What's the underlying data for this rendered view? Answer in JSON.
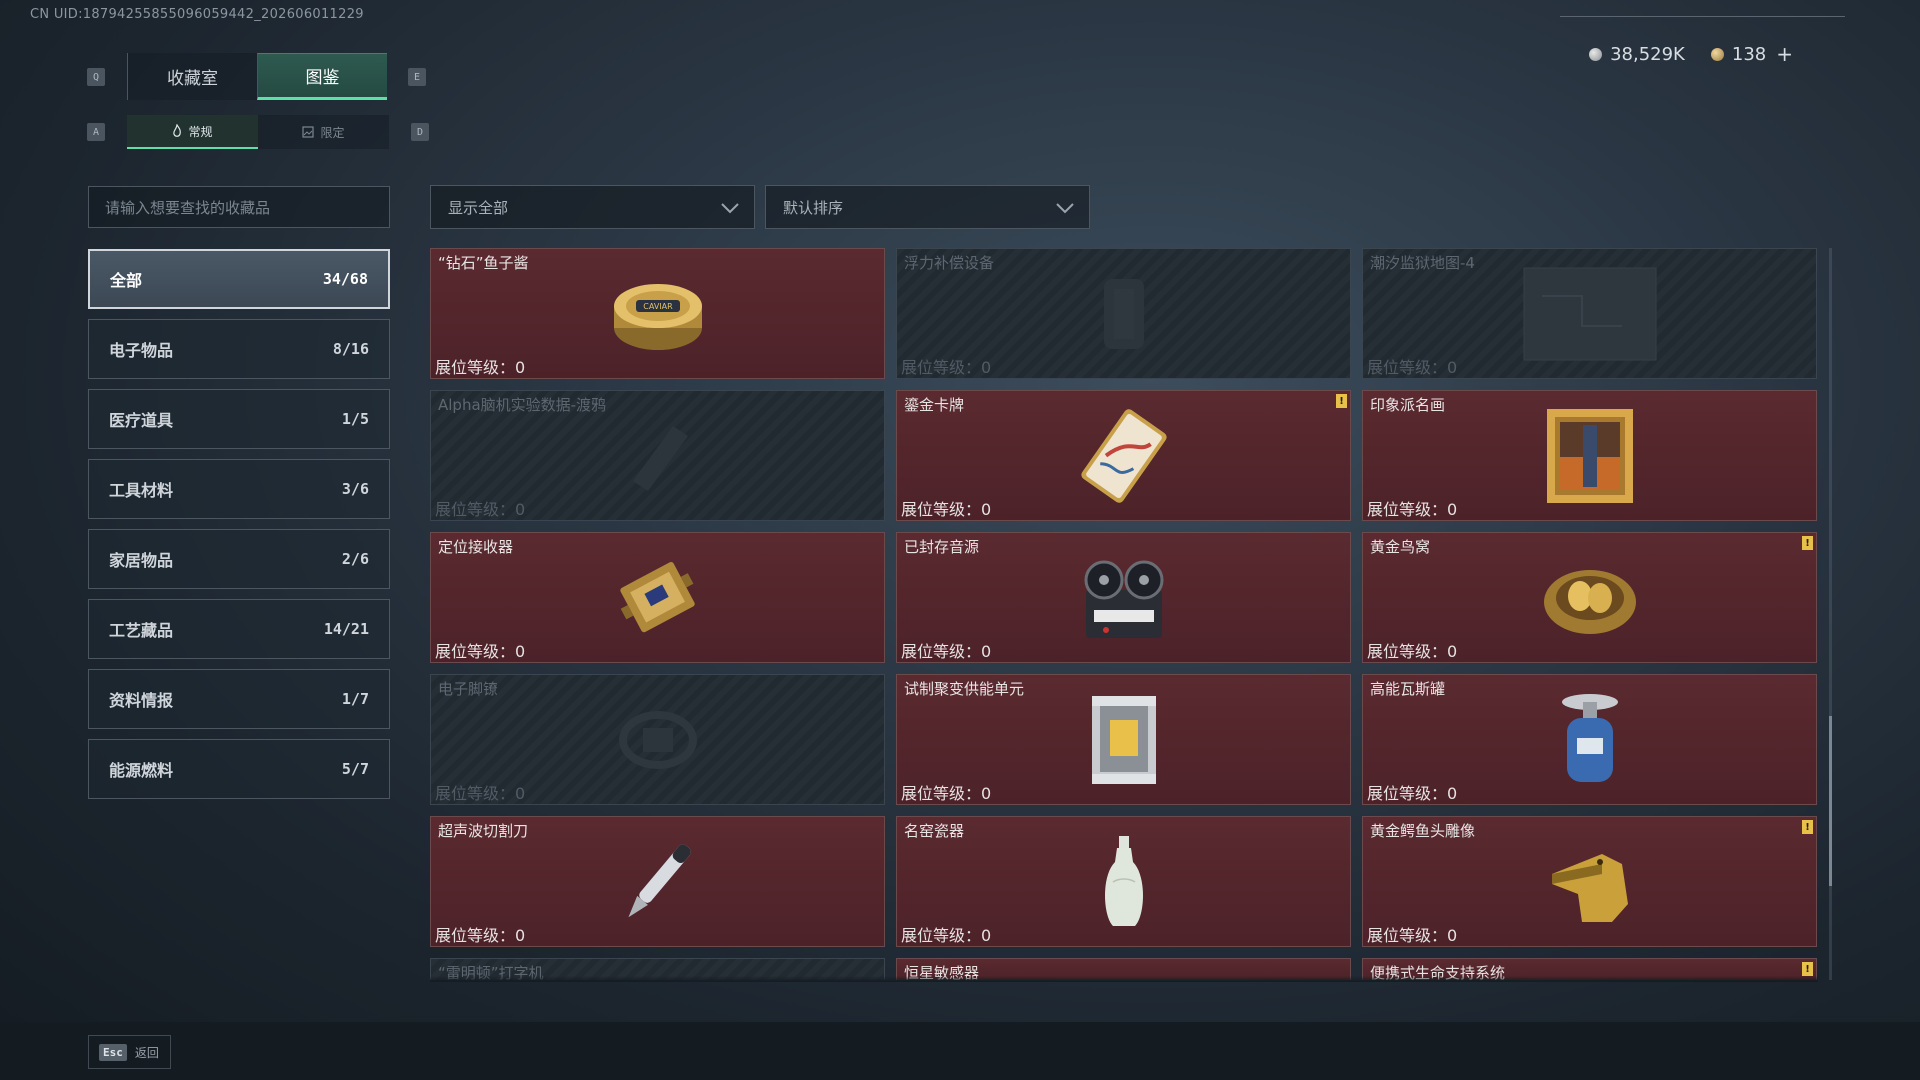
{
  "uid": "CN UID:18794255855096059442_202606011229",
  "currency": {
    "silver": "38,529K",
    "gold": "138",
    "add": "+"
  },
  "keys": {
    "q": "Q",
    "e": "E",
    "a": "A",
    "d": "D"
  },
  "tabs": [
    {
      "label": "收藏室"
    },
    {
      "label": "图鉴"
    }
  ],
  "subtabs": [
    {
      "label": "常规"
    },
    {
      "label": "限定"
    }
  ],
  "search": {
    "placeholder": "请输入想要查找的收藏品"
  },
  "filter": {
    "selected": "显示全部"
  },
  "sort": {
    "selected": "默认排序"
  },
  "categories": [
    {
      "name": "全部",
      "count": "34/68"
    },
    {
      "name": "电子物品",
      "count": "8/16"
    },
    {
      "name": "医疗道具",
      "count": "1/5"
    },
    {
      "name": "工具材料",
      "count": "3/6"
    },
    {
      "name": "家居物品",
      "count": "2/6"
    },
    {
      "name": "工艺藏品",
      "count": "14/21"
    },
    {
      "name": "资料情报",
      "count": "1/7"
    },
    {
      "name": "能源燃料",
      "count": "5/7"
    }
  ],
  "level_label": "展位等级：",
  "items": [
    {
      "name": "“钻石”鱼子酱",
      "level": "0",
      "locked": false,
      "badge": false,
      "icon": "caviar-tin-icon"
    },
    {
      "name": "浮力补偿设备",
      "level": "0",
      "locked": true,
      "badge": false,
      "icon": "buoyancy-device-icon"
    },
    {
      "name": "潮汐监狱地图-4",
      "level": "0",
      "locked": true,
      "badge": false,
      "icon": "map-icon"
    },
    {
      "name": "Alpha脑机实验数据-渡鸦",
      "level": "0",
      "locked": true,
      "badge": false,
      "icon": "data-drive-icon"
    },
    {
      "name": "鎏金卡牌",
      "level": "0",
      "locked": false,
      "badge": true,
      "icon": "gilded-card-icon"
    },
    {
      "name": "印象派名画",
      "level": "0",
      "locked": false,
      "badge": false,
      "icon": "painting-icon"
    },
    {
      "name": "定位接收器",
      "level": "0",
      "locked": false,
      "badge": false,
      "icon": "receiver-icon"
    },
    {
      "name": "已封存音源",
      "level": "0",
      "locked": false,
      "badge": false,
      "icon": "tape-recorder-icon"
    },
    {
      "name": "黄金鸟窝",
      "level": "0",
      "locked": false,
      "badge": true,
      "icon": "golden-nest-icon"
    },
    {
      "name": "电子脚镣",
      "level": "0",
      "locked": true,
      "badge": false,
      "icon": "ankle-monitor-icon"
    },
    {
      "name": "试制聚变供能单元",
      "level": "0",
      "locked": false,
      "badge": false,
      "icon": "fusion-unit-icon"
    },
    {
      "name": "高能瓦斯罐",
      "level": "0",
      "locked": false,
      "badge": false,
      "icon": "gas-canister-icon"
    },
    {
      "name": "超声波切割刀",
      "level": "0",
      "locked": false,
      "badge": false,
      "icon": "cutter-icon"
    },
    {
      "name": "名窑瓷器",
      "level": "0",
      "locked": false,
      "badge": false,
      "icon": "porcelain-vase-icon"
    },
    {
      "name": "黄金鳄鱼头雕像",
      "level": "0",
      "locked": false,
      "badge": true,
      "icon": "gold-crocodile-icon"
    },
    {
      "name": "“雷明顿”打字机",
      "level": "",
      "locked": true,
      "badge": false,
      "icon": "typewriter-icon"
    },
    {
      "name": "恒星敏感器",
      "level": "",
      "locked": false,
      "badge": false,
      "icon": "star-sensor-icon"
    },
    {
      "name": "便携式生命支持系统",
      "level": "",
      "locked": false,
      "badge": true,
      "icon": "life-support-icon"
    }
  ],
  "badge_mark": "!",
  "footer": {
    "key": "Esc",
    "label": "返回"
  },
  "colors": {
    "accent": "#5ee0a8",
    "owned_card": "#5a2a30",
    "locked_card": "#262e36",
    "badge": "#e8c04a"
  }
}
